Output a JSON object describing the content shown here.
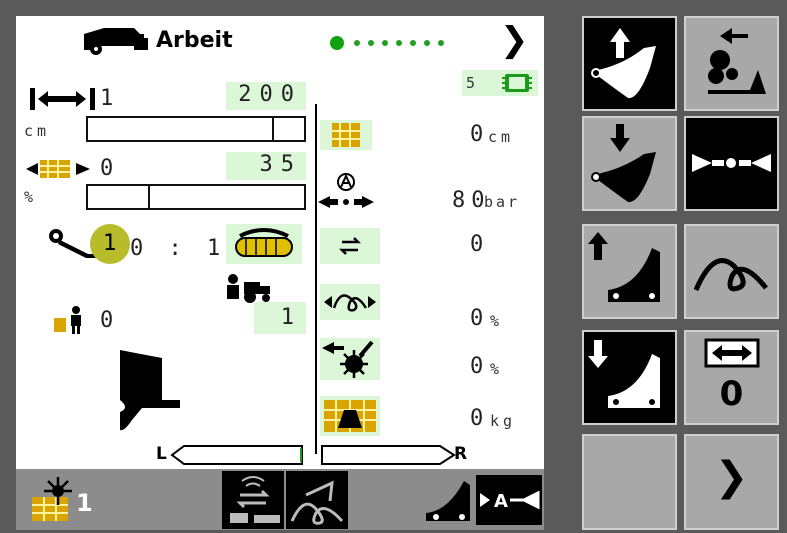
{
  "header": {
    "title": "Arbeit",
    "page_dots_total": 8,
    "page_dots_active": 1,
    "next_glyph": "❯"
  },
  "left": {
    "bale_length_setting": "1",
    "bale_length_value": "200",
    "length_unit": "cm",
    "length_bar_fraction": 0.85,
    "filling_setting": "0",
    "filling_value": "35",
    "filling_unit": "%",
    "filling_bar_fraction": 0.28,
    "knotter_ratio": "0 : 1",
    "callout_number": "1",
    "operator_count": "0",
    "tractor_value": "1"
  },
  "right": {
    "monitor_badge": "5",
    "bale_length_cm": "0",
    "bale_length_unit": "cm",
    "pressure_value": "80",
    "pressure_unit": "bar",
    "counter_value": "0",
    "knot_percent": "0",
    "knot_unit": "%",
    "cutter_percent": "0",
    "cutter_unit": "%",
    "weight_value": "0",
    "weight_unit": "kg"
  },
  "steering": {
    "left_label": "L",
    "right_label": "R",
    "left_indicator": 0.95
  },
  "footer": {
    "bale_count": "1",
    "accent": "#f0c000"
  },
  "sidebar": {
    "buttons": [
      {
        "name": "tailgate-up-button",
        "icon": "chute-up-icon"
      },
      {
        "name": "unload-left-button",
        "icon": "unload-icon"
      },
      {
        "name": "tailgate-down-button",
        "icon": "chute-down-icon"
      },
      {
        "name": "center-button",
        "icon": "center-arrows-icon"
      },
      {
        "name": "ramp-up-button",
        "icon": "ramp-up-icon"
      },
      {
        "name": "knotter-button",
        "icon": "knotter-icon"
      },
      {
        "name": "ramp-down-button",
        "icon": "ramp-down-icon"
      },
      {
        "name": "reset-width-button",
        "icon": "reset-width-icon",
        "label": "0"
      },
      {
        "name": "blank-button",
        "icon": ""
      },
      {
        "name": "next-page-button",
        "icon": "chevron-right-icon",
        "label": "❯"
      }
    ]
  }
}
